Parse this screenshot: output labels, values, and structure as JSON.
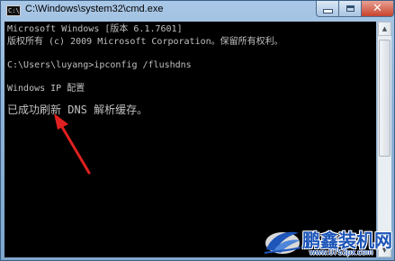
{
  "window": {
    "title": "C:\\Windows\\system32\\cmd.exe",
    "icon": "cmd-console-icon",
    "icon_text": "C:\\",
    "close_glyph": "✕"
  },
  "console": {
    "lines": [
      "Microsoft Windows [版本 6.1.7601]",
      "版权所有 (c) 2009 Microsoft Corporation。保留所有权利。",
      "",
      "C:\\Users\\luyang>ipconfig /flushdns",
      "",
      "Windows IP 配置",
      "",
      "已成功刷新 DNS 解析缓存。"
    ]
  },
  "annotation": {
    "arrow_color": "#e02020"
  },
  "watermark": {
    "name": "鹏鑫装机网",
    "url": "www.0753px.com"
  },
  "colors": {
    "console_bg": "#000000",
    "console_text": "#c0c0c0",
    "brand_blue": "#1d55b8"
  }
}
